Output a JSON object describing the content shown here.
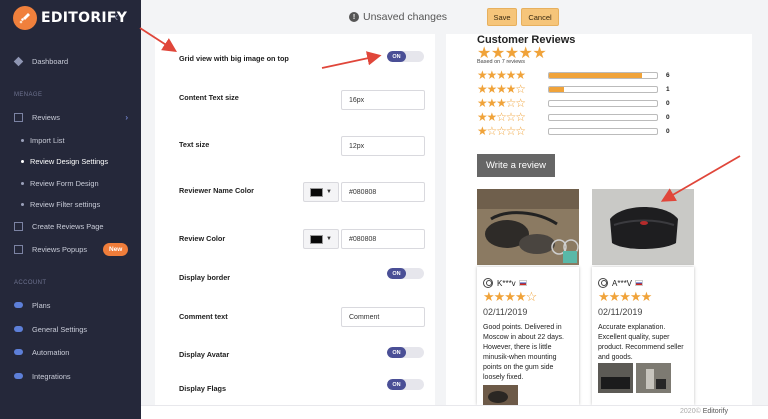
{
  "sidebar": {
    "brand": "EDITORIFY",
    "collapse_glyph": "‹",
    "sections": {
      "menage": "MENAGE",
      "account": "ACCOUNT"
    },
    "items": {
      "dashboard": "Dashboard",
      "reviews": "Reviews",
      "import_list": "Import List",
      "review_design": "Review Design Settings",
      "review_form": "Review Form Design",
      "review_filter": "Review Filter settings",
      "create_page": "Create Reviews Page",
      "popups": "Reviews Popups",
      "plans": "Plans",
      "general": "General Settings",
      "automation": "Automation",
      "integrations": "Integrations"
    },
    "new_badge": "New"
  },
  "topbar": {
    "unsaved": "Unsaved changes",
    "info_glyph": "!",
    "save": "Save",
    "cancel": "Cancel"
  },
  "settings": {
    "grid_view": {
      "label": "Grid view with big image on top",
      "state": "ON"
    },
    "content_text_size": {
      "label": "Content Text size",
      "value": "16px"
    },
    "text_size": {
      "label": "Text size",
      "value": "12px"
    },
    "reviewer_name_color": {
      "label": "Reviewer Name Color",
      "value": "#080808"
    },
    "review_color": {
      "label": "Review Color",
      "value": "#080808"
    },
    "display_border": {
      "label": "Display border",
      "state": "ON"
    },
    "comment_text": {
      "label": "Comment text",
      "value": "Comment"
    },
    "display_avatar": {
      "label": "Display Avatar",
      "state": "ON"
    },
    "display_flags": {
      "label": "Display Flags",
      "state": "ON"
    },
    "caret": "▼"
  },
  "preview": {
    "title": "Customer Reviews",
    "average_stars": "★★★★★",
    "based_on": "Based on 7 reviews",
    "histogram": [
      {
        "stars": "★★★★★",
        "count": "6",
        "fill": 0.86
      },
      {
        "stars": "★★★★☆",
        "count": "1",
        "fill": 0.14
      },
      {
        "stars": "★★★☆☆",
        "count": "0",
        "fill": 0
      },
      {
        "stars": "★★☆☆☆",
        "count": "0",
        "fill": 0
      },
      {
        "stars": "★☆☆☆☆",
        "count": "0",
        "fill": 0
      }
    ],
    "write_review": "Write a review",
    "reviews": [
      {
        "name": "K***v",
        "stars": "★★★★☆",
        "date": "02/11/2019",
        "text": "Good points. Delivered in Moscow in about 22 days. However, there is little minusik-when mounting points on the gum side loosely fixed."
      },
      {
        "name": "A***V",
        "stars": "★★★★★",
        "date": "02/11/2019",
        "text": "Accurate explanation. Excellent quality, super product. Recommend seller and goods."
      }
    ]
  },
  "footer": {
    "year": "2020©",
    "brand": "Editorify"
  },
  "colors": {
    "sidebar": "#25283a",
    "accent": "#f0a33a",
    "toggle_on": "#4a4f96",
    "badge": "#f07d3a",
    "arrow": "#e0463a"
  }
}
